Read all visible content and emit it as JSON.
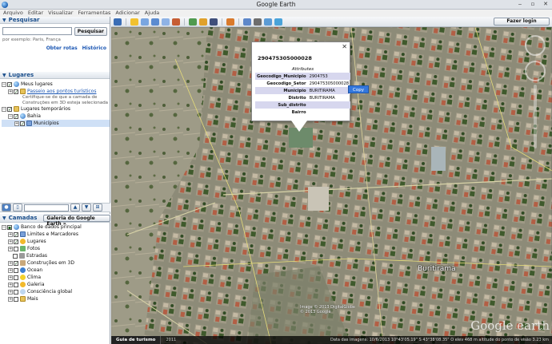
{
  "window": {
    "title": "Google Earth",
    "minimize": "‒",
    "maximize": "▫",
    "close": "✕"
  },
  "menu": [
    "Arquivo",
    "Editar",
    "Visualizar",
    "Ferramentas",
    "Adicionar",
    "Ajuda"
  ],
  "search": {
    "header": "Pesquisar",
    "button": "Pesquisar",
    "hint": "por exemplo: Paris, França",
    "link_routes": "Obter rotas",
    "link_history": "Histórico"
  },
  "places": {
    "header": "Lugares",
    "my_places": "Meus lugares",
    "tour": "Passeio aos pontos turísticos",
    "tour_note": "Certifique-se de que a camada de Construções em 3D esteja selecionada",
    "temp_places": "Lugares temporários",
    "bahia": "Bahia",
    "municipios": "Municípios"
  },
  "layers": {
    "header": "Camadas",
    "gallery_button": "Galeria do Google Earth »",
    "items": [
      "Banco de dados principal",
      "Limites e Marcadores",
      "Lugares",
      "Fotos",
      "Estradas",
      "Construções em 3D",
      "Ocean",
      "Clima",
      "Galeria",
      "Consciência global",
      "Mais"
    ]
  },
  "toolbar": {
    "login": "Fazer login"
  },
  "popup": {
    "close": "✕",
    "title": "290475305000028",
    "caption": "Attributes",
    "rows": [
      {
        "key": "Geocodigo_Municipio",
        "value": "2904753"
      },
      {
        "key": "Geocodigo_Setor",
        "value": "290475305000028"
      },
      {
        "key": "Municipio",
        "value": "BURITIRAMA"
      },
      {
        "key": "Distrito",
        "value": "BURITIRAMA"
      },
      {
        "key": "Sub_distrito",
        "value": ""
      },
      {
        "key": "Bairro",
        "value": ""
      }
    ],
    "copy": "Copy"
  },
  "map": {
    "place_label": "Buritirama",
    "watermark": "Google earth",
    "copyright_1": "Image © 2013 DigitalGlobe",
    "copyright_2": "© 2013 Google"
  },
  "status": {
    "tour_button": "Guia de turismo",
    "year": "2011",
    "text": "Data das imagens: 10/6/2013   10°43'05.19\" S  43°38'08.35\" O  elev  468 m   altitude do ponto de visão  3.23 km"
  }
}
